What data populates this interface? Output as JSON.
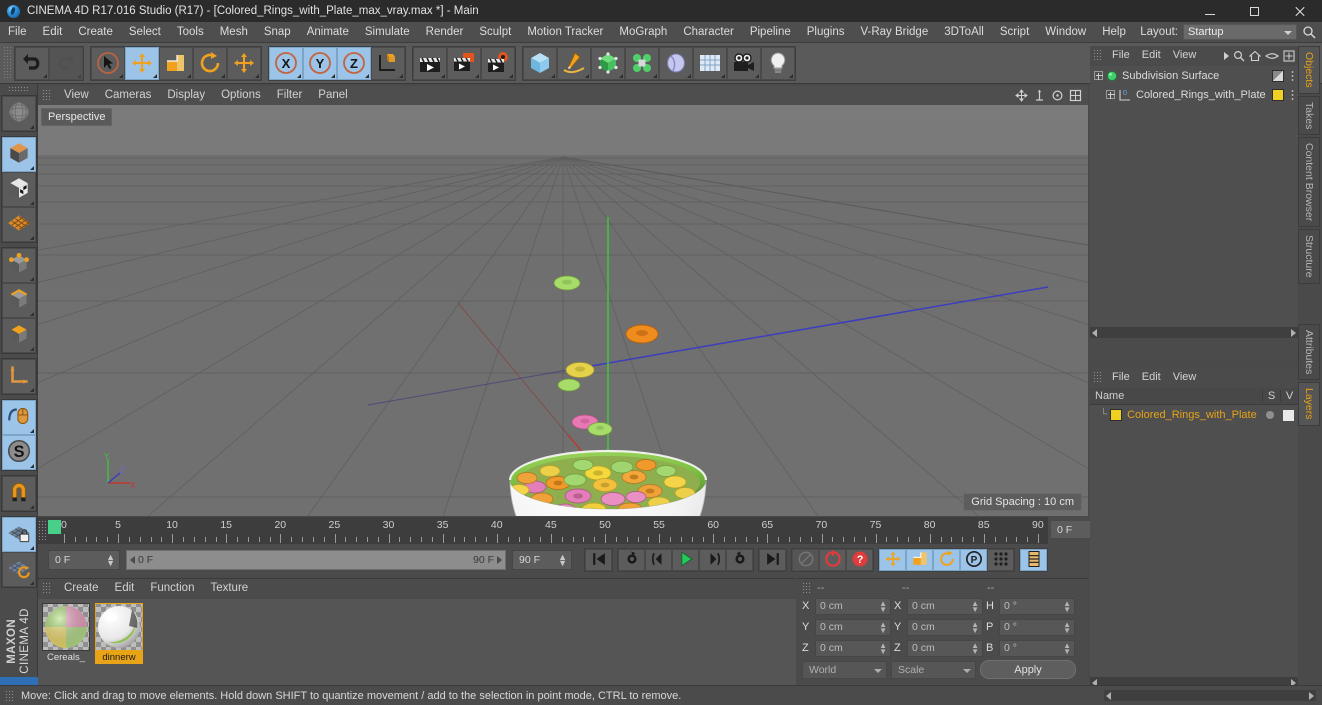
{
  "window": {
    "title": "CINEMA 4D R17.016 Studio (R17) - [Colored_Rings_with_Plate_max_vray.max *] - Main",
    "minimize": "minimize-button",
    "maximize": "maximize-button",
    "close": "close-button"
  },
  "menubar": {
    "items": [
      "File",
      "Edit",
      "Create",
      "Select",
      "Tools",
      "Mesh",
      "Snap",
      "Animate",
      "Simulate",
      "Render",
      "Sculpt",
      "Motion Tracker",
      "MoGraph",
      "Character",
      "Pipeline",
      "Plugins",
      "V-Ray Bridge",
      "3DToAll",
      "Script",
      "Window",
      "Help"
    ],
    "layout_label": "Layout:",
    "layout_value": "Startup"
  },
  "toolbar": {
    "groups": [
      {
        "name": "undo-redo",
        "buttons": [
          {
            "name": "undo-button",
            "icon": "undo-arrow-icon",
            "active": false,
            "dim": false
          },
          {
            "name": "redo-button",
            "icon": "redo-arrow-icon",
            "active": false,
            "dim": true
          }
        ]
      },
      {
        "name": "transform-tools",
        "buttons": [
          {
            "name": "live-selection-tool",
            "icon": "cursor-circle-icon",
            "active": false,
            "dim": false
          },
          {
            "name": "move-tool",
            "icon": "move-arrows-icon",
            "active": true,
            "dim": false
          },
          {
            "name": "scale-tool",
            "icon": "scale-box-icon",
            "active": false,
            "dim": false
          },
          {
            "name": "rotate-tool",
            "icon": "rotate-circle-icon",
            "active": false,
            "dim": false
          },
          {
            "name": "move-secondary-tool",
            "icon": "move-arrows-icon",
            "active": false,
            "dim": false
          }
        ]
      },
      {
        "name": "axis-locks",
        "buttons": [
          {
            "name": "x-axis-lock-button",
            "icon": "x-axis-icon",
            "active": true,
            "dim": false
          },
          {
            "name": "y-axis-lock-button",
            "icon": "y-axis-icon",
            "active": true,
            "dim": false
          },
          {
            "name": "z-axis-lock-button",
            "icon": "z-axis-icon",
            "active": true,
            "dim": false
          },
          {
            "name": "world-object-coordinate-button",
            "icon": "world-axis-cube-icon",
            "active": false,
            "dim": false
          }
        ]
      },
      {
        "name": "render-tools",
        "buttons": [
          {
            "name": "render-view-button",
            "icon": "clapperboard-icon",
            "active": false,
            "dim": false
          },
          {
            "name": "render-to-picture-viewer-button",
            "icon": "clapperboard-window-icon",
            "active": false,
            "dim": false
          },
          {
            "name": "render-settings-button",
            "icon": "clapperboard-gear-icon",
            "active": false,
            "dim": false
          }
        ]
      },
      {
        "name": "object-creation",
        "buttons": [
          {
            "name": "add-cube-object-button",
            "icon": "blue-cube-icon",
            "active": false,
            "dim": false
          },
          {
            "name": "add-spline-button",
            "icon": "pen-spline-icon",
            "active": false,
            "dim": false
          },
          {
            "name": "add-generator-button",
            "icon": "green-cube-icon",
            "active": false,
            "dim": false
          },
          {
            "name": "add-deformer-button",
            "icon": "green-cluster-icon",
            "active": false,
            "dim": false
          },
          {
            "name": "add-environment-button",
            "icon": "sky-blob-icon",
            "active": false,
            "dim": false
          },
          {
            "name": "add-floor-button",
            "icon": "grid-floor-icon",
            "active": false,
            "dim": false
          },
          {
            "name": "add-camera-button",
            "icon": "camera-icon",
            "active": false,
            "dim": false
          },
          {
            "name": "add-light-button",
            "icon": "light-bulb-icon",
            "active": false,
            "dim": false
          }
        ]
      }
    ]
  },
  "left_toolbar": {
    "buttons": [
      {
        "name": "make-editable-button",
        "icon": "sphere-wireframe-icon",
        "active": false
      },
      {
        "name": "model-mode-button",
        "icon": "orange-cube-icon",
        "active": true
      },
      {
        "name": "texture-mode-button",
        "icon": "checker-cube-icon",
        "active": false
      },
      {
        "name": "uv-mode-button",
        "icon": "orange-mesh-grid-icon",
        "active": false
      },
      {
        "name": "points-mode-button",
        "icon": "points-cube-icon",
        "active": false
      },
      {
        "name": "edges-mode-button",
        "icon": "edges-cube-icon",
        "active": false
      },
      {
        "name": "polygons-mode-button",
        "icon": "polygon-cube-icon",
        "active": false
      },
      {
        "name": "object-axis-button",
        "icon": "axis-corner-icon",
        "active": false
      },
      {
        "name": "enable-axis-modification-button",
        "icon": "mouse-axis-icon",
        "active": true
      },
      {
        "name": "soft-selection-button",
        "icon": "s-circle-icon",
        "active": true
      },
      {
        "name": "magnet-tool-button",
        "icon": "magnet-icon",
        "active": false
      },
      {
        "name": "lock-workplane-button",
        "icon": "grid-lock-icon",
        "active": true
      },
      {
        "name": "workplane-rotate-button",
        "icon": "grid-rotate-icon",
        "active": false
      }
    ],
    "brand_top": "MAXON",
    "brand_bottom": "CINEMA 4D"
  },
  "viewport": {
    "menu_items": [
      "View",
      "Cameras",
      "Display",
      "Options",
      "Filter",
      "Panel"
    ],
    "label": "Perspective",
    "grid_spacing": "Grid Spacing : 10 cm",
    "axis_gizmo": {
      "y": "Y",
      "x": "X",
      "z": "Z"
    },
    "icons": [
      "viewport-move-icon",
      "viewport-scale-icon",
      "viewport-rotate-icon",
      "viewport-maximize-icon"
    ]
  },
  "timeline": {
    "tick_labels": [
      "0",
      "5",
      "10",
      "15",
      "20",
      "25",
      "30",
      "35",
      "40",
      "45",
      "50",
      "55",
      "60",
      "65",
      "70",
      "75",
      "80",
      "85",
      "90"
    ],
    "current_frame_box": "0 F",
    "start_field": "0 F",
    "range_start": "0 F",
    "range_end": "90 F",
    "end_field": "90 F",
    "playback_buttons": [
      {
        "name": "go-to-start-button",
        "icon": "skip-start-icon",
        "active": false,
        "dim": false
      },
      {
        "name": "go-to-previous-key-button",
        "icon": "prev-key-icon",
        "active": false,
        "dim": false
      },
      {
        "name": "step-back-button",
        "icon": "step-back-icon",
        "active": false,
        "dim": false
      },
      {
        "name": "play-button",
        "icon": "play-triangle-icon",
        "active": false,
        "dim": false
      },
      {
        "name": "step-forward-button",
        "icon": "step-forward-icon",
        "active": false,
        "dim": false
      },
      {
        "name": "go-to-next-key-button",
        "icon": "next-key-icon",
        "active": false,
        "dim": false
      },
      {
        "name": "go-to-end-button",
        "icon": "skip-end-icon",
        "active": false,
        "dim": false
      },
      {
        "name": "record-active-objects-button",
        "icon": "record-disabled-icon",
        "active": false,
        "dim": true
      },
      {
        "name": "autokeying-button",
        "icon": "red-circle-icon",
        "active": false,
        "dim": false
      },
      {
        "name": "keyframe-selection-button",
        "icon": "red-question-icon",
        "active": false,
        "dim": false
      },
      {
        "name": "record-position-button",
        "icon": "position-move-icon",
        "active": true,
        "dim": false
      },
      {
        "name": "record-scale-button",
        "icon": "scale-icon",
        "active": true,
        "dim": false
      },
      {
        "name": "record-rotation-button",
        "icon": "rotation-icon",
        "active": true,
        "dim": false
      },
      {
        "name": "record-pla-button",
        "icon": "p-circle-icon",
        "active": true,
        "dim": false
      },
      {
        "name": "record-point-level-button",
        "icon": "dots-grid-icon",
        "active": false,
        "dim": false
      },
      {
        "name": "timeline-view-button",
        "icon": "timeline-strip-icon",
        "active": true,
        "dim": false
      }
    ]
  },
  "material_manager": {
    "menu_items": [
      "Create",
      "Edit",
      "Function",
      "Texture"
    ],
    "materials": [
      {
        "name": "Cereals_",
        "selected": false
      },
      {
        "name": "dinnerw",
        "selected": true
      }
    ]
  },
  "coordinates": {
    "headers": [
      "--",
      "--",
      "--"
    ],
    "rows": [
      {
        "label1": "X",
        "value1": "0 cm",
        "label2": "X",
        "value2": "0 cm",
        "label3": "H",
        "value3": "0 °"
      },
      {
        "label1": "Y",
        "value1": "0 cm",
        "label2": "Y",
        "value2": "0 cm",
        "label3": "P",
        "value3": "0 °"
      },
      {
        "label1": "Z",
        "value1": "0 cm",
        "label2": "Z",
        "value2": "0 cm",
        "label3": "B",
        "value3": "0 °"
      }
    ],
    "system_select": "World",
    "mode_select": "Scale",
    "apply_button": "Apply"
  },
  "object_manager": {
    "menu_items": [
      "File",
      "Edit",
      "View"
    ],
    "icons": [
      "arrow-right-icon",
      "search-icon",
      "home-icon",
      "eye-icon",
      "frame-icon"
    ],
    "objects": [
      {
        "name": "Subdivision Surface",
        "indent": 0,
        "icon": "green-sphere-icon",
        "chip_color": "",
        "tag_color": ""
      },
      {
        "name": "Colored_Rings_with_Plate",
        "indent": 1,
        "icon": "polygon-object-icon",
        "chip_color": "#f0d020",
        "tag_color": "#f0d020"
      }
    ]
  },
  "attribute_manager": {
    "menu_items": [
      "File",
      "Edit",
      "View"
    ],
    "columns": [
      "Name",
      "S",
      "V"
    ],
    "rows": [
      {
        "name": "Colored_Rings_with_Plate",
        "color": "#f0d020"
      }
    ]
  },
  "vertical_tabs_top": [
    {
      "label": "Objects",
      "active": true
    },
    {
      "label": "Takes",
      "active": false
    },
    {
      "label": "Content Browser",
      "active": false
    },
    {
      "label": "Structure",
      "active": false
    }
  ],
  "vertical_tabs_bottom": [
    {
      "label": "Attributes",
      "active": false
    },
    {
      "label": "Layers",
      "active": true
    }
  ],
  "statusbar": {
    "message": "Move: Click and drag to move elements. Hold down SHIFT to quantize movement / add to the selection in point mode, CTRL to remove."
  },
  "colors": {
    "accent_orange": "#e8a317",
    "active_blue": "#9cc4e8",
    "bowl_green": "#7cc143",
    "panel_bg": "#4b4b4b",
    "viewport_bg": "#6e6e6e",
    "x_axis": "#c0392b",
    "y_axis": "#3fc43f",
    "z_axis": "#3b3bc4"
  }
}
